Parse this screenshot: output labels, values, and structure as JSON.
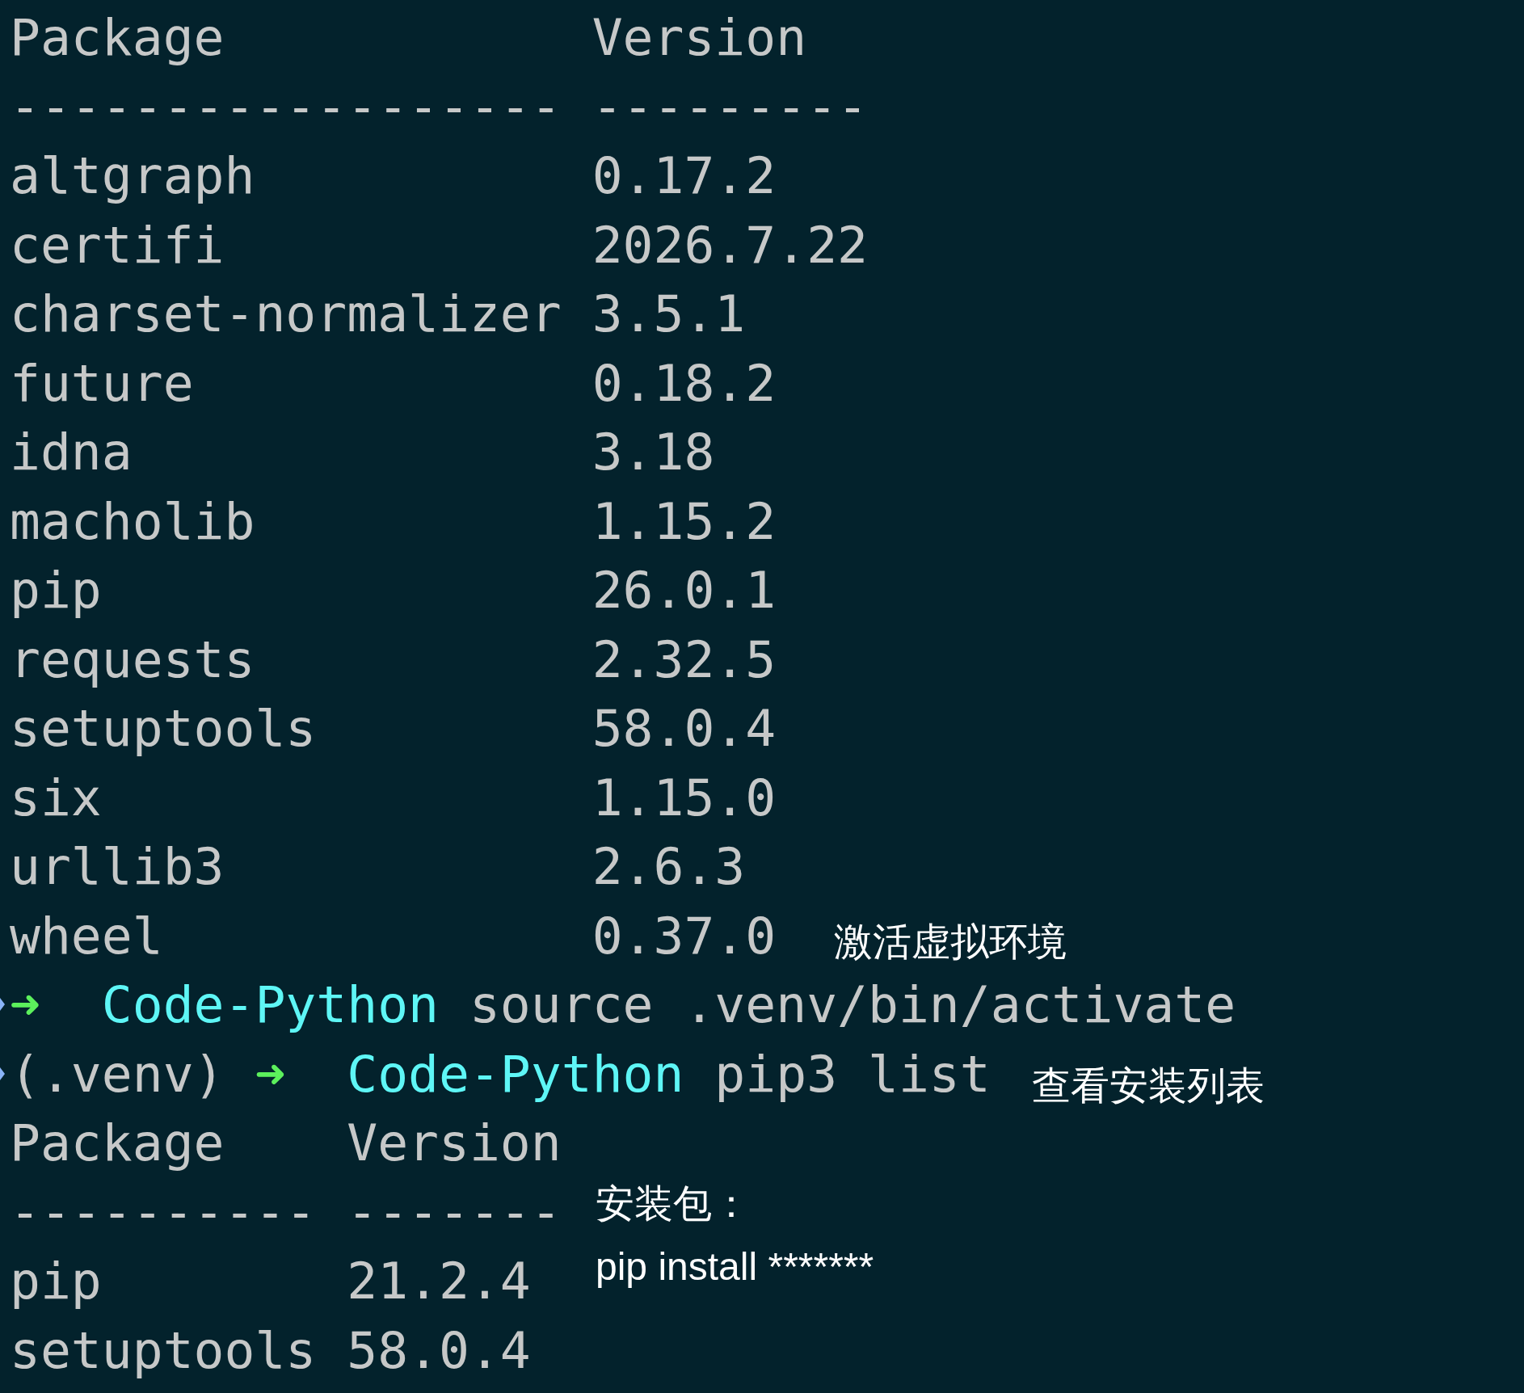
{
  "listing_1": {
    "columns": [
      "Package",
      "Version"
    ],
    "separators": [
      "------------------",
      "---------"
    ],
    "rows": [
      {
        "package": "altgraph",
        "version": "0.17.2"
      },
      {
        "package": "certifi",
        "version": "2026.7.22"
      },
      {
        "package": "charset-normalizer",
        "version": "3.5.1"
      },
      {
        "package": "future",
        "version": "0.18.2"
      },
      {
        "package": "idna",
        "version": "3.18"
      },
      {
        "package": "macholib",
        "version": "1.15.2"
      },
      {
        "package": "pip",
        "version": "26.0.1"
      },
      {
        "package": "requests",
        "version": "2.32.5"
      },
      {
        "package": "setuptools",
        "version": "58.0.4"
      },
      {
        "package": "six",
        "version": "1.15.0"
      },
      {
        "package": "urllib3",
        "version": "2.6.3"
      },
      {
        "package": "wheel",
        "version": "0.37.0"
      }
    ]
  },
  "prompts": [
    {
      "arrow": "➜",
      "directory": "Code-Python",
      "command": "source .venv/bin/activate"
    },
    {
      "env": "(.venv)",
      "arrow": "➜",
      "directory": "Code-Python",
      "command": "pip3 list"
    }
  ],
  "listing_2": {
    "columns": [
      "Package",
      "Version"
    ],
    "separators": [
      "----------",
      "-------"
    ],
    "rows": [
      {
        "package": "pip",
        "version": "21.2.4"
      },
      {
        "package": "setuptools",
        "version": "58.0.4"
      }
    ]
  },
  "annotations": [
    "激活虚拟环境",
    "查看安装列表",
    "安装包：",
    "pip install *******"
  ]
}
